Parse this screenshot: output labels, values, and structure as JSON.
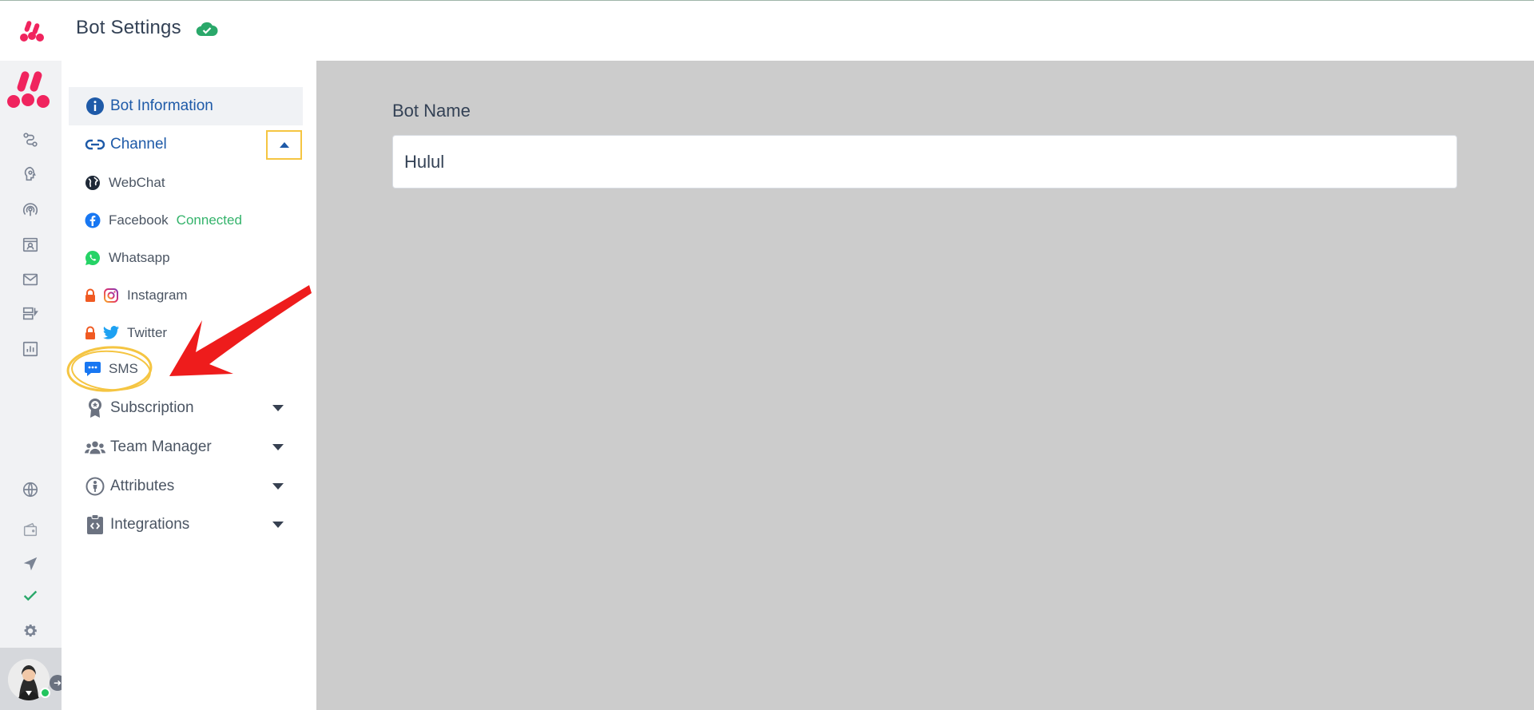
{
  "header": {
    "title": "Bot Settings"
  },
  "nav": {
    "bot_information": "Bot Information",
    "channel": "Channel",
    "channels": [
      {
        "label": "WebChat",
        "icon": "globe-icon"
      },
      {
        "label": "Facebook",
        "icon": "facebook-icon",
        "status": "Connected"
      },
      {
        "label": "Whatsapp",
        "icon": "whatsapp-icon"
      },
      {
        "label": "Instagram",
        "icon": "instagram-icon",
        "locked": true
      },
      {
        "label": "Twitter",
        "icon": "twitter-icon",
        "locked": true
      },
      {
        "label": "SMS",
        "icon": "sms-icon"
      }
    ],
    "subscription": "Subscription",
    "team_manager": "Team Manager",
    "attributes": "Attributes",
    "integrations": "Integrations"
  },
  "form": {
    "bot_name_label": "Bot Name",
    "bot_name_value": "Hulul"
  },
  "colors": {
    "brand": "#f0245e",
    "link_blue": "#1e5aa8",
    "connected_green": "#34b36b",
    "highlight_yellow": "#f5c542",
    "annotation_red": "#ee1c1c",
    "main_bg": "#cccccc"
  }
}
